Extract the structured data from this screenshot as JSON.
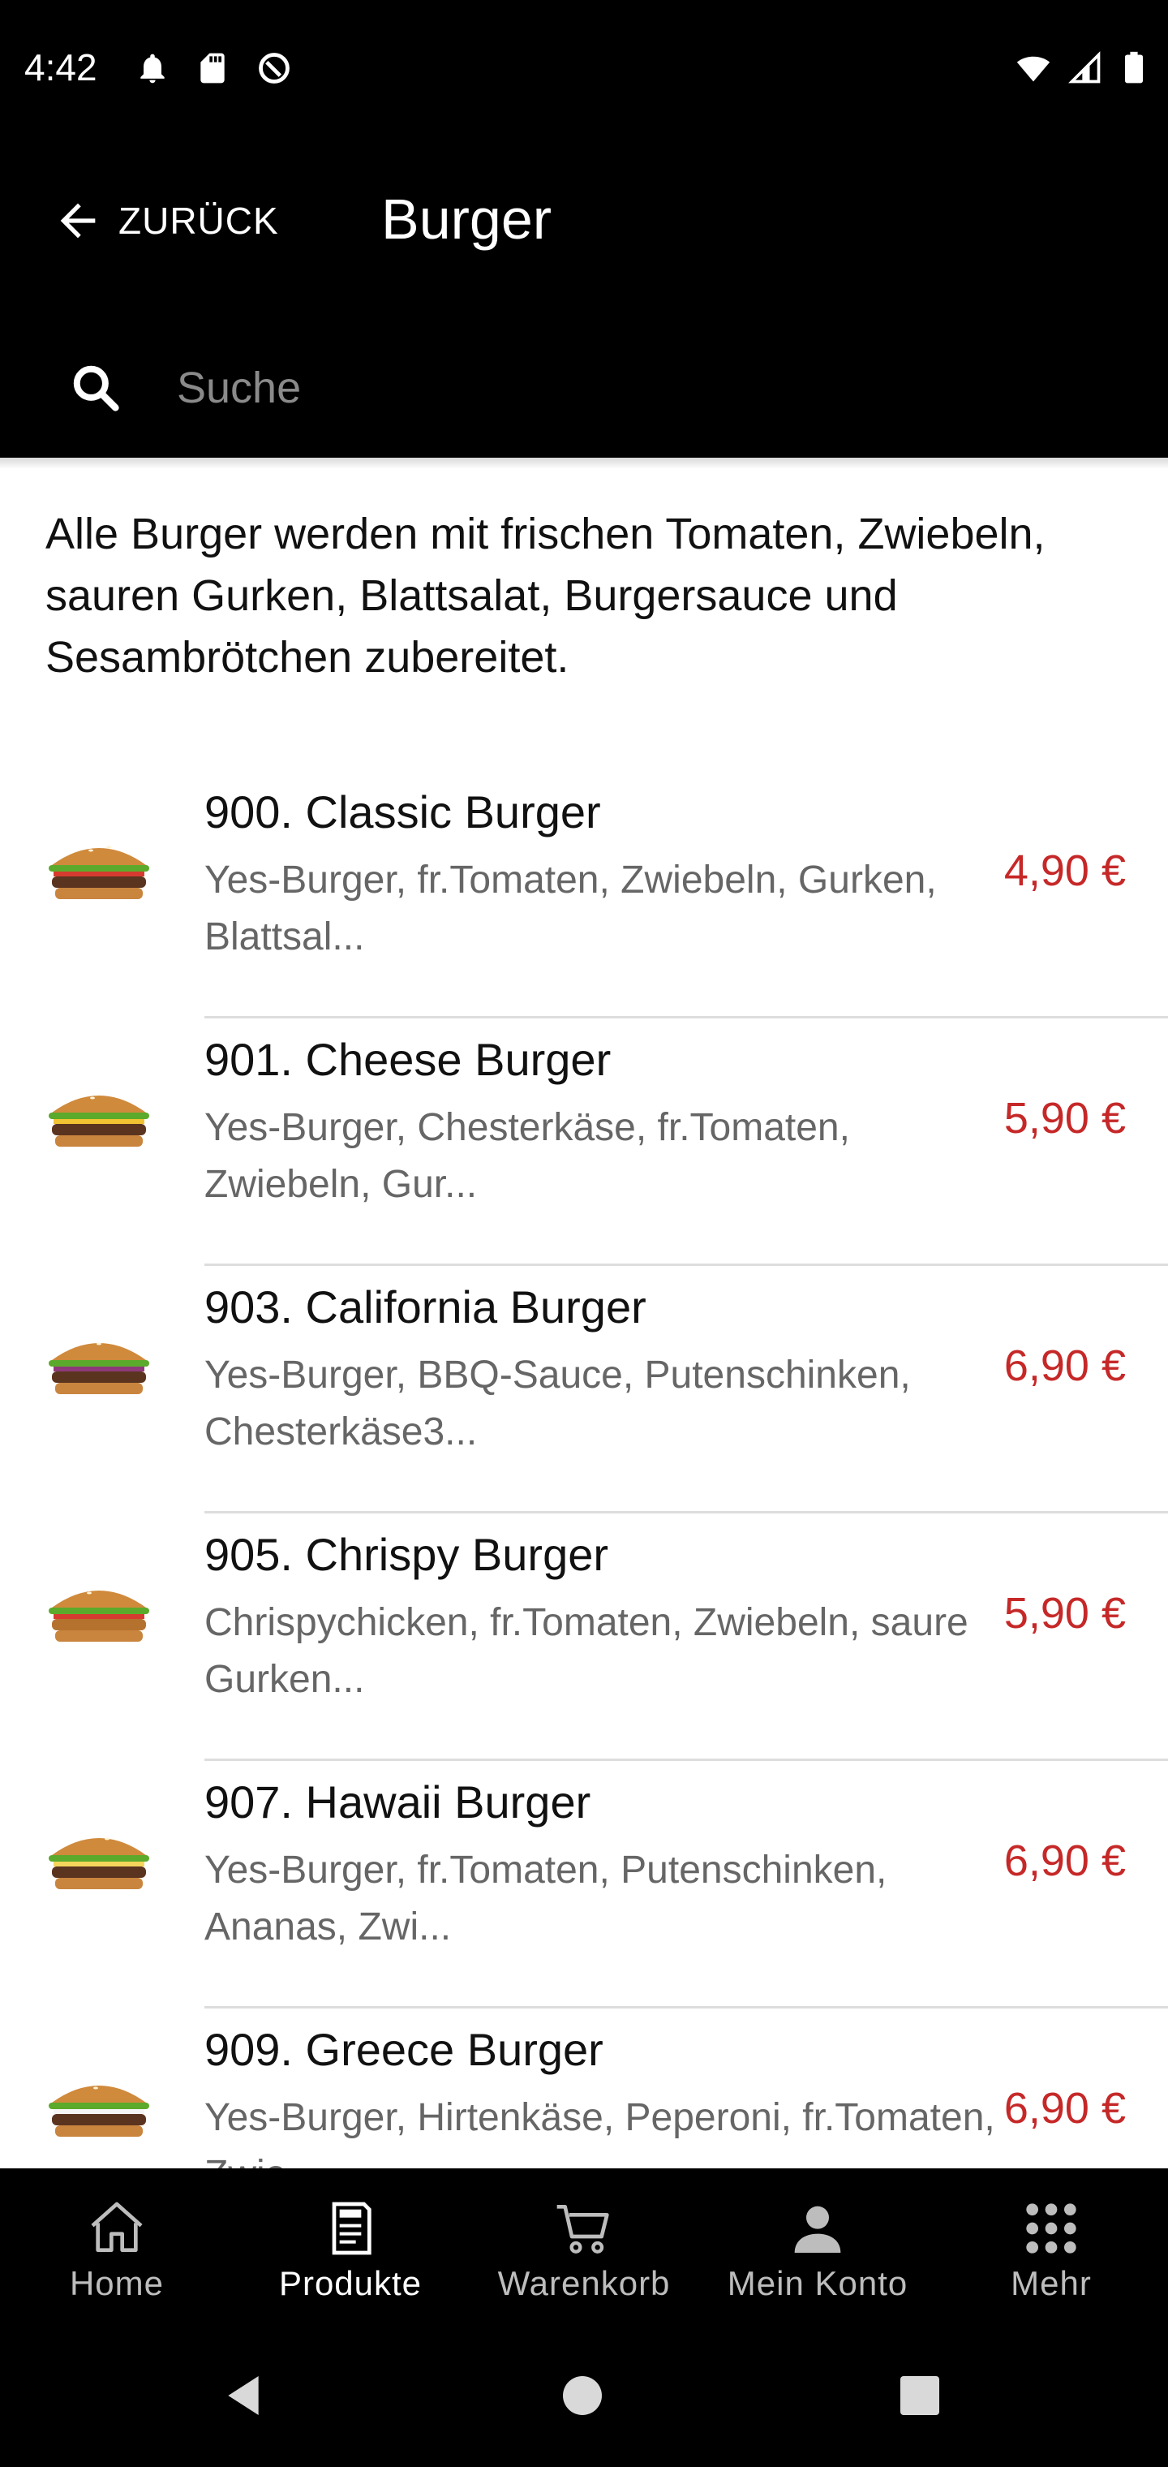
{
  "status_bar": {
    "time": "4:42"
  },
  "app_bar": {
    "back_label": "ZURÜCK",
    "title": "Burger"
  },
  "search": {
    "placeholder": "Suche"
  },
  "category_description": "Alle Burger werden mit frischen Tomaten, Zwiebeln, sauren Gurken, Blattsalat, Burgersauce und Sesambrötchen zubereitet.",
  "products": [
    {
      "name": "900. Classic Burger",
      "description": "Yes-Burger, fr.Tomaten, Zwiebeln, Gurken, Blattsal...",
      "price": "4,90 €"
    },
    {
      "name": "901. Cheese Burger",
      "description": "Yes-Burger, Chesterkäse, fr.Tomaten, Zwiebeln, Gur...",
      "price": "5,90 €"
    },
    {
      "name": "903. California Burger",
      "description": "Yes-Burger, BBQ-Sauce, Putenschinken, Chesterkäse3...",
      "price": "6,90 €"
    },
    {
      "name": "905. Chrispy Burger",
      "description": "Chrispychicken, fr.Tomaten, Zwiebeln, saure Gurken...",
      "price": "5,90 €"
    },
    {
      "name": "907. Hawaii Burger",
      "description": "Yes-Burger, fr.Tomaten, Putenschinken, Ananas, Zwi...",
      "price": "6,90 €"
    },
    {
      "name": "909. Greece Burger",
      "description": "Yes-Burger, Hirtenkäse, Peperoni, fr.Tomaten, Zwie...",
      "price": "6,90 €"
    }
  ],
  "bottom_nav": [
    {
      "label": "Home",
      "icon": "home-icon"
    },
    {
      "label": "Produkte",
      "icon": "menu-icon",
      "active": true
    },
    {
      "label": "Warenkorb",
      "icon": "cart-icon"
    },
    {
      "label": "Mein Konto",
      "icon": "person-icon"
    },
    {
      "label": "Mehr",
      "icon": "grid-icon"
    }
  ],
  "colors": {
    "price": "#c62828",
    "bar_background": "#000000"
  }
}
